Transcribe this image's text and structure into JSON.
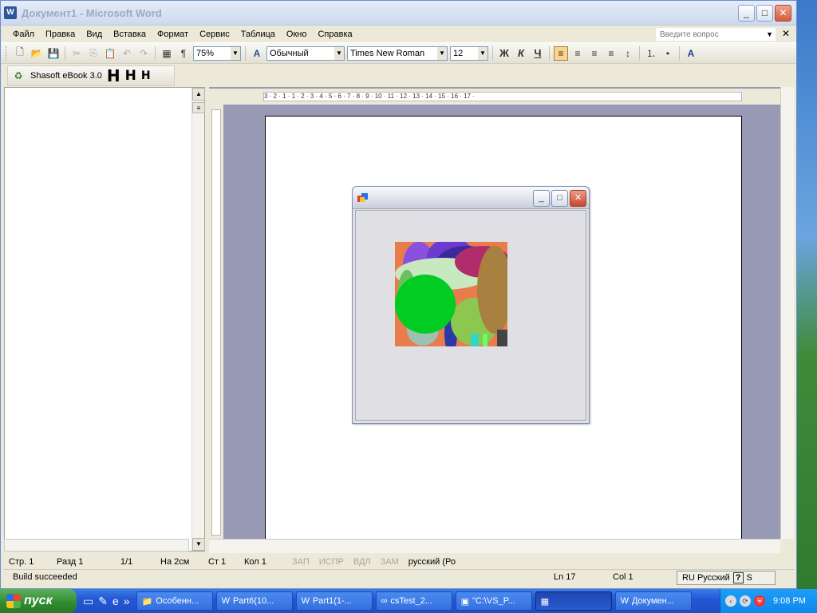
{
  "window": {
    "title": "Документ1 - Microsoft Word",
    "app_icon": "W"
  },
  "menu": {
    "items": [
      "Файл",
      "Правка",
      "Вид",
      "Вставка",
      "Формат",
      "Сервис",
      "Таблица",
      "Окно",
      "Справка"
    ],
    "ask_placeholder": "Введите вопрос"
  },
  "toolbar": {
    "zoom": "75%",
    "style": "Обычный",
    "font": "Times New Roman",
    "size": "12",
    "bold": "Ж",
    "italic": "К",
    "underline": "Ч",
    "paragraph": "¶"
  },
  "toolbar2": {
    "label": "Shasoft eBook 3.0",
    "h1": "H",
    "h2": "H",
    "h3": "H"
  },
  "ruler": {
    "text": "3 · 2 · 1 · 1 · 2 · 3 · 4 · 5 · 6 · 7 · 8 · 9 · 10 · 11 · 12 · 13 · 14 · 15 · 16 · 17 ·"
  },
  "status": {
    "page": "Стр. 1",
    "section": "Разд 1",
    "pages": "1/1",
    "at": "На 2см",
    "line": "Ст 1",
    "col": "Кол 1",
    "rec": "ЗАП",
    "trk": "ИСПР",
    "ext": "ВДЛ",
    "ovr": "ЗАМ",
    "lang": "русский (Ро"
  },
  "output": {
    "build": "Build succeeded",
    "ln": "Ln 17",
    "col": "Col 1",
    "lang": "RU Русский",
    "s": "S"
  },
  "taskbar": {
    "start": "пуск",
    "tasks": [
      "Особенн...",
      "Part6(10...",
      "Part1(1-...",
      "csTest_2...",
      "\"C:\\VS_P...",
      "",
      "Докумен..."
    ],
    "clock": "9:08 PM"
  },
  "colors": {
    "accent": "#2458d6",
    "start": "#2f8a2f"
  }
}
